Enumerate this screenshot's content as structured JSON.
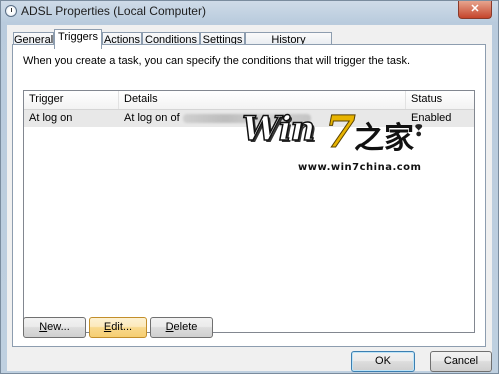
{
  "window": {
    "title": "ADSL Properties (Local Computer)"
  },
  "tabs": [
    {
      "label": "General"
    },
    {
      "label": "Triggers"
    },
    {
      "label": "Actions"
    },
    {
      "label": "Conditions"
    },
    {
      "label": "Settings"
    },
    {
      "label": "History (disabled)"
    }
  ],
  "active_tab": "Triggers",
  "description": "When you create a task, you can specify the conditions that will trigger the task.",
  "triggers_table": {
    "columns": [
      "Trigger",
      "Details",
      "Status"
    ],
    "rows": [
      {
        "trigger": "At log on",
        "details": "At log on of",
        "status": "Enabled"
      }
    ]
  },
  "watermark": {
    "text_win": "Win",
    "text_seven": "7",
    "text_cn": "之家",
    "url": "www.win7china.com"
  },
  "buttons": {
    "new": {
      "label": "New...",
      "mnemonic": "N",
      "rest": "ew..."
    },
    "edit": {
      "label": "Edit...",
      "mnemonic": "E",
      "rest": "dit..."
    },
    "delete": {
      "label": "Delete",
      "mnemonic": "D",
      "rest": "elete"
    },
    "ok": "OK",
    "cancel": "Cancel"
  }
}
